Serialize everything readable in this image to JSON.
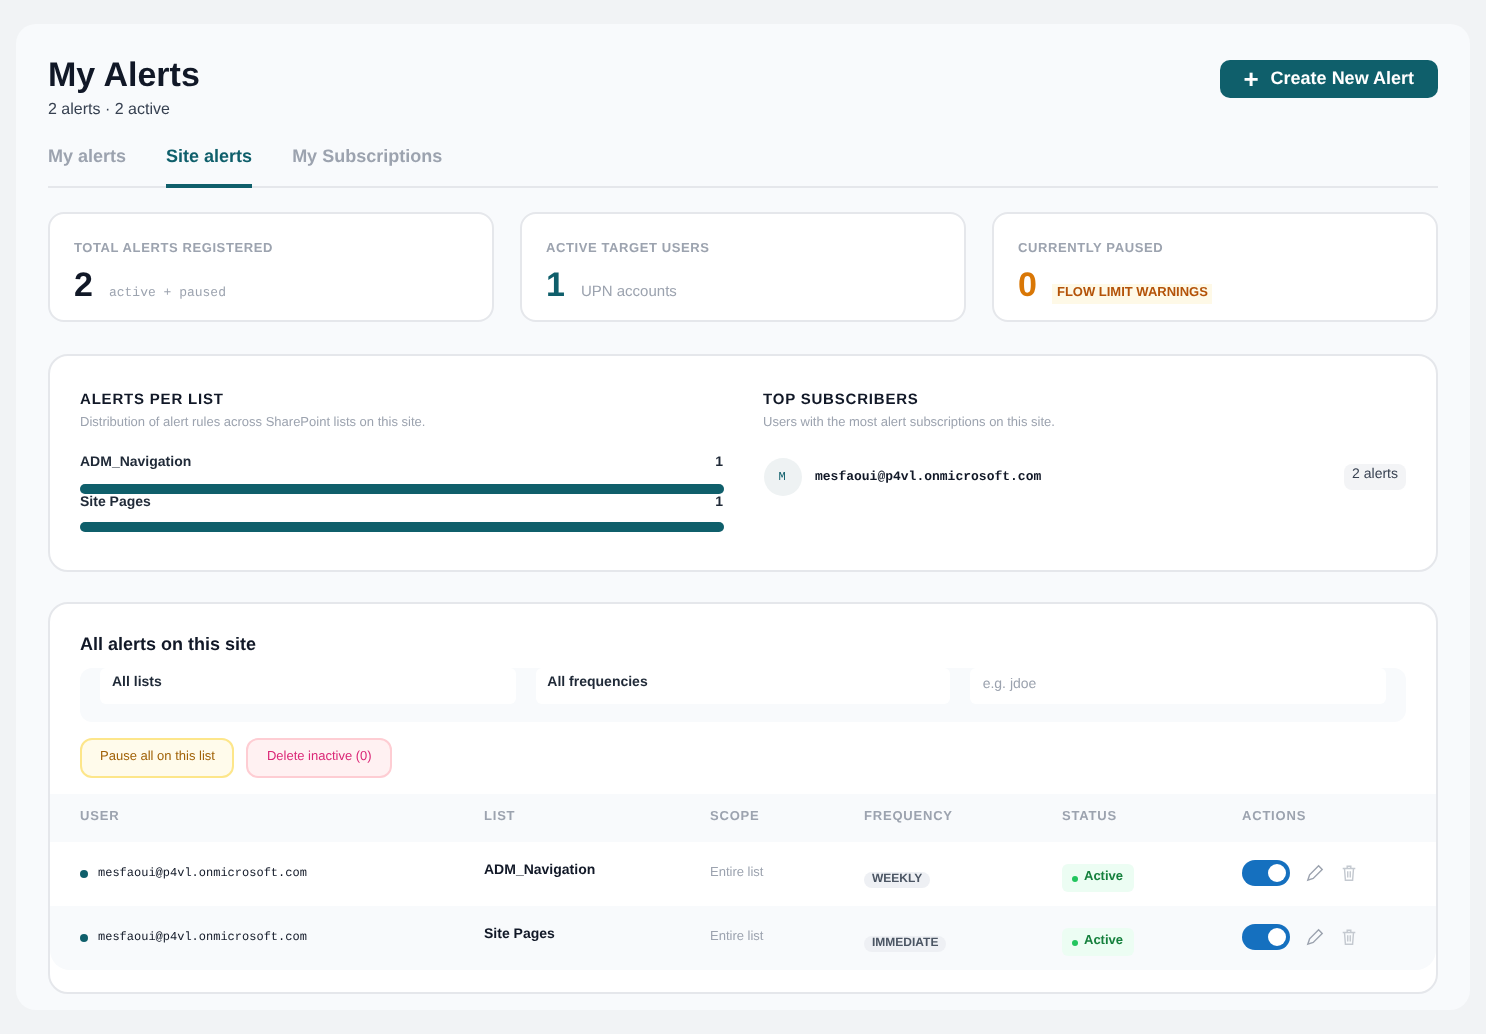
{
  "header": {
    "title": "My Alerts",
    "subtitle": "2 alerts · 2 active",
    "create_button": {
      "label": "Create New Alert",
      "icon": "+"
    }
  },
  "tabs": [
    {
      "label": "My alerts",
      "selected": false
    },
    {
      "label": "Site alerts",
      "selected": true
    },
    {
      "label": "My Subscriptions",
      "selected": false
    }
  ],
  "stats": [
    {
      "label": "TOTAL ALERTS REGISTERED",
      "value": "2",
      "note": "active + paused",
      "kind": "plain"
    },
    {
      "label": "ACTIVE TARGET USERS",
      "value": "1",
      "note": "UPN accounts",
      "kind": "accent"
    },
    {
      "label": "CURRENTLY PAUSED",
      "value": "0",
      "note": "FLOW LIMIT WARNINGS",
      "kind": "warning"
    }
  ],
  "alerts_per_list": {
    "title": "ALERTS PER LIST",
    "description": "Distribution of alert rules across SharePoint lists on this site.",
    "items": [
      {
        "name": "ADM_Navigation",
        "count": "1",
        "level": 1
      },
      {
        "name": "Site Pages",
        "count": "1",
        "level": 1
      }
    ]
  },
  "top_subscribers": {
    "title": "TOP SUBSCRIBERS",
    "description": "Users with the most alert subscriptions on this site.",
    "items": [
      {
        "initial": "M",
        "email": "mesfaoui@p4vl.onmicrosoft.com",
        "count": "2 alerts"
      }
    ]
  },
  "all_alerts": {
    "title": "All alerts on this site",
    "filters": [
      {
        "kind": "select",
        "value": "All lists"
      },
      {
        "kind": "select",
        "value": "All frequencies"
      },
      {
        "kind": "text",
        "placeholder": "e.g. jdoe"
      }
    ],
    "actions": [
      {
        "label": "Pause all on this list",
        "kind": "warning"
      },
      {
        "label": "Delete inactive (0)",
        "kind": "danger"
      }
    ],
    "columns": [
      "USER",
      "LIST",
      "SCOPE",
      "FREQUENCY",
      "STATUS",
      "ACTIONS"
    ],
    "rows": [
      {
        "user": "mesfaoui@p4vl.onmicrosoft.com",
        "list": "ADM_Navigation",
        "scope": "Entire list",
        "frequency": "WEEKLY",
        "status": "Active",
        "on": true
      },
      {
        "user": "mesfaoui@p4vl.onmicrosoft.com",
        "list": "Site Pages",
        "scope": "Entire list",
        "frequency": "IMMEDIATE",
        "status": "Active",
        "on": true
      }
    ]
  }
}
